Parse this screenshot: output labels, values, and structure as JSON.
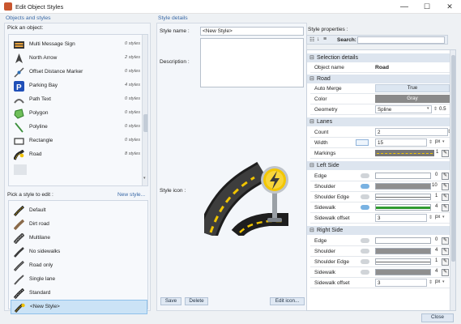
{
  "window": {
    "title": "Edit Object Styles",
    "minimize": "—",
    "maximize": "☐",
    "close": "✕"
  },
  "left": {
    "section_title": "Objects and styles",
    "pick_object_label": "Pick an object:",
    "objects": [
      {
        "label": "Multi Message Sign",
        "count": "0 styles",
        "icon": "sign-icon"
      },
      {
        "label": "North Arrow",
        "count": "2 styles",
        "icon": "north-arrow-icon"
      },
      {
        "label": "Offset Distance Marker",
        "count": "0 styles",
        "icon": "marker-icon"
      },
      {
        "label": "Parking Bay",
        "count": "4 styles",
        "icon": "parking-icon"
      },
      {
        "label": "Path Text",
        "count": "0 styles",
        "icon": "path-text-icon"
      },
      {
        "label": "Polygon",
        "count": "0 styles",
        "icon": "polygon-icon"
      },
      {
        "label": "Polyline",
        "count": "0 styles",
        "icon": "polyline-icon"
      },
      {
        "label": "Rectangle",
        "count": "0 styles",
        "icon": "rectangle-icon"
      },
      {
        "label": "Road",
        "count": "8 styles",
        "icon": "road-icon"
      }
    ],
    "pick_style_label": "Pick a style to edit :",
    "new_style_link": "New style...",
    "styles": [
      {
        "label": "Default"
      },
      {
        "label": "Dirt road"
      },
      {
        "label": "Multilane"
      },
      {
        "label": "No sidewalks"
      },
      {
        "label": "Road only"
      },
      {
        "label": "Single lane"
      },
      {
        "label": "Standard"
      },
      {
        "label": "<New Style>"
      }
    ]
  },
  "middle": {
    "section_title": "Style details",
    "style_name_label": "Style name :",
    "style_name_value": "<New Style>",
    "description_label": "Description :",
    "style_icon_label": "Style icon :",
    "save_button": "Save",
    "delete_button": "Delete",
    "edit_icon_button": "Edit icon..."
  },
  "props": {
    "title": "Style properties :",
    "search_label": "Search:",
    "search_value": "",
    "selection_details": {
      "header": "Selection details",
      "object_name_label": "Object name",
      "object_name_value": "Road"
    },
    "road": {
      "header": "Road",
      "auto_merge_label": "Auto Merge",
      "auto_merge_value": "True",
      "color_label": "Color",
      "color_value": "Gray",
      "geometry_label": "Geometry",
      "geometry_value": "Spline",
      "geometry_num": "0.5"
    },
    "lanes": {
      "header": "Lanes",
      "count_label": "Count",
      "count_value": "2",
      "width_label": "Width",
      "width_value": "15",
      "width_unit": "px",
      "markings_label": "Markings",
      "markings_num": "1"
    },
    "left_side": {
      "header": "Left Side",
      "edge_label": "Edge",
      "edge_num": "0",
      "shoulder_label": "Shoulder",
      "shoulder_num": "10",
      "shoulder_edge_label": "Shoulder Edge",
      "shoulder_edge_num": "1",
      "sidewalk_label": "Sidewalk",
      "sidewalk_num": "4",
      "sidewalk_offset_label": "Sidewalk offset",
      "sidewalk_offset_value": "3",
      "sidewalk_offset_unit": "px"
    },
    "right_side": {
      "header": "Right Side",
      "edge_label": "Edge",
      "edge_num": "0",
      "shoulder_label": "Shoulder",
      "shoulder_num": "4",
      "shoulder_edge_label": "Shoulder Edge",
      "shoulder_edge_num": "1",
      "sidewalk_label": "Sidewalk",
      "sidewalk_num": "4",
      "sidewalk_offset_label": "Sidewalk offset",
      "sidewalk_offset_value": "3",
      "sidewalk_offset_unit": "px"
    }
  },
  "footer": {
    "close_button": "Close"
  },
  "colors": {
    "accent": "#3868a6",
    "selection": "#cbe3f6",
    "road_gray": "#8a8a8a",
    "sidewalk_green": "#2f9a2f",
    "shoulder_gray": "#8f8f8f"
  }
}
